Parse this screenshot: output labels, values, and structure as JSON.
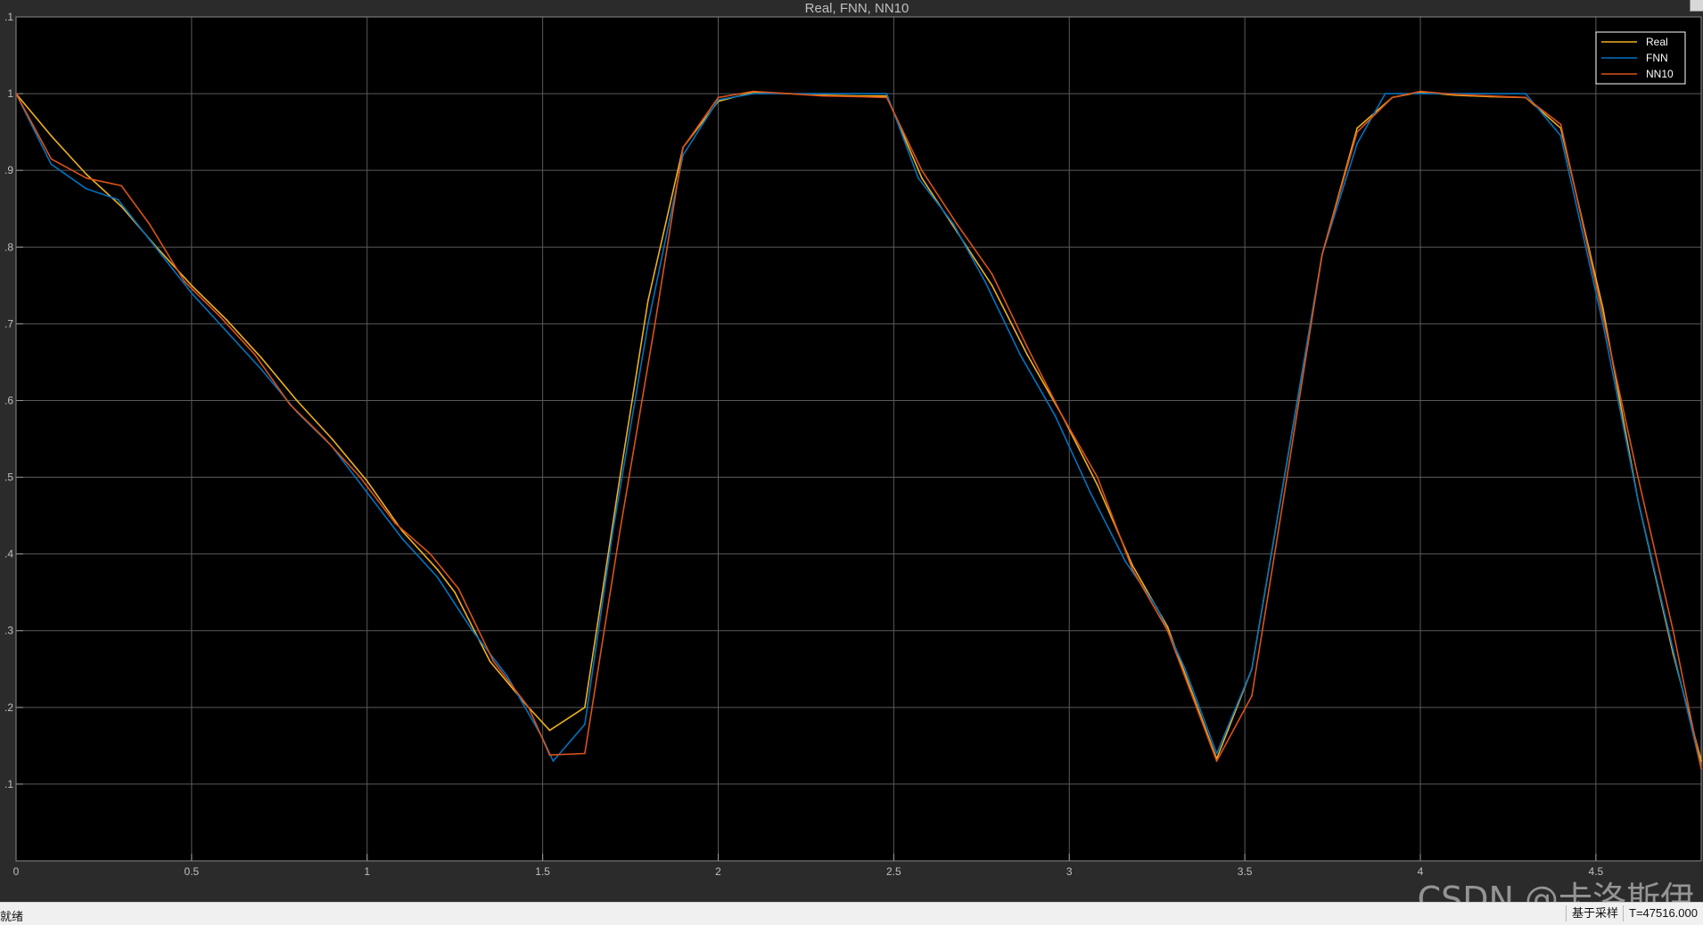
{
  "window": {
    "status_text": "就绪",
    "sampling_label": "基于采样",
    "time_readout": "T=47516.000",
    "watermark": "CSDN @卡洛斯伊"
  },
  "colors": {
    "background": "#000000",
    "frame": "#2b2b2b",
    "grid": "#5a5a5a",
    "axis_text": "#bfbfbf",
    "title_text": "#bfbfbf",
    "legend_border": "#ffffff"
  },
  "chart_data": {
    "type": "line",
    "title": "Real, FNN, NN10",
    "xlabel": "",
    "ylabel": "",
    "xlim": [
      0,
      4.8
    ],
    "ylim": [
      0,
      1.1
    ],
    "grid": true,
    "legend_position": "top-right",
    "x_ticks": [
      0,
      0.5,
      1,
      1.5,
      2,
      2.5,
      3,
      3.5,
      4,
      4.5
    ],
    "x_tick_labels": [
      "0",
      "0.5",
      "1",
      "1.5",
      "2",
      "2.5",
      "3",
      "3.5",
      "4",
      "4.5"
    ],
    "y_ticks": [
      0.1,
      0.2,
      0.3,
      0.4,
      0.5,
      0.6,
      0.7,
      0.8,
      0.9,
      1,
      1.1
    ],
    "y_tick_labels": [
      ".1",
      ".2",
      ".3",
      ".4",
      ".5",
      ".6",
      ".7",
      ".8",
      ".9",
      "1",
      ".1"
    ],
    "series": [
      {
        "name": "Real",
        "color": "#edb120",
        "points": [
          [
            0,
            1.0
          ],
          [
            0.1,
            0.945
          ],
          [
            0.2,
            0.895
          ],
          [
            0.3,
            0.853
          ],
          [
            0.4,
            0.8
          ],
          [
            0.5,
            0.75
          ],
          [
            0.6,
            0.705
          ],
          [
            0.7,
            0.655
          ],
          [
            0.8,
            0.6
          ],
          [
            0.9,
            0.55
          ],
          [
            1.0,
            0.495
          ],
          [
            1.1,
            0.43
          ],
          [
            1.2,
            0.38
          ],
          [
            1.25,
            0.35
          ],
          [
            1.35,
            0.26
          ],
          [
            1.45,
            0.205
          ],
          [
            1.52,
            0.17
          ],
          [
            1.62,
            0.2
          ],
          [
            1.72,
            0.5
          ],
          [
            1.8,
            0.73
          ],
          [
            1.9,
            0.93
          ],
          [
            2.0,
            0.99
          ],
          [
            2.1,
            1.002
          ],
          [
            2.2,
            1.0
          ],
          [
            2.3,
            0.998
          ],
          [
            2.4,
            0.997
          ],
          [
            2.48,
            0.997
          ],
          [
            2.58,
            0.89
          ],
          [
            2.68,
            0.82
          ],
          [
            2.78,
            0.75
          ],
          [
            2.88,
            0.66
          ],
          [
            2.98,
            0.58
          ],
          [
            3.08,
            0.49
          ],
          [
            3.18,
            0.385
          ],
          [
            3.28,
            0.305
          ],
          [
            3.42,
            0.133
          ],
          [
            3.52,
            0.25
          ],
          [
            3.62,
            0.52
          ],
          [
            3.72,
            0.79
          ],
          [
            3.82,
            0.955
          ],
          [
            3.92,
            0.995
          ],
          [
            4.0,
            1.002
          ],
          [
            4.1,
            0.998
          ],
          [
            4.2,
            0.996
          ],
          [
            4.3,
            0.995
          ],
          [
            4.4,
            0.955
          ],
          [
            4.52,
            0.72
          ],
          [
            4.62,
            0.47
          ],
          [
            4.72,
            0.27
          ],
          [
            4.8,
            0.13
          ]
        ]
      },
      {
        "name": "FNN",
        "color": "#0072bd",
        "points": [
          [
            0,
            1.0
          ],
          [
            0.1,
            0.908
          ],
          [
            0.2,
            0.876
          ],
          [
            0.29,
            0.862
          ],
          [
            0.38,
            0.81
          ],
          [
            0.5,
            0.74
          ],
          [
            0.6,
            0.69
          ],
          [
            0.7,
            0.64
          ],
          [
            0.8,
            0.585
          ],
          [
            0.9,
            0.54
          ],
          [
            1.0,
            0.48
          ],
          [
            1.1,
            0.42
          ],
          [
            1.2,
            0.37
          ],
          [
            1.3,
            0.3
          ],
          [
            1.4,
            0.24
          ],
          [
            1.5,
            0.16
          ],
          [
            1.53,
            0.13
          ],
          [
            1.62,
            0.178
          ],
          [
            1.7,
            0.43
          ],
          [
            1.8,
            0.7
          ],
          [
            1.9,
            0.92
          ],
          [
            2.0,
            0.992
          ],
          [
            2.1,
            1.0
          ],
          [
            2.2,
            1.0
          ],
          [
            2.3,
            1.0
          ],
          [
            2.4,
            1.0
          ],
          [
            2.48,
            1.0
          ],
          [
            2.57,
            0.89
          ],
          [
            2.67,
            0.83
          ],
          [
            2.76,
            0.755
          ],
          [
            2.86,
            0.66
          ],
          [
            2.96,
            0.58
          ],
          [
            3.06,
            0.48
          ],
          [
            3.16,
            0.39
          ],
          [
            3.25,
            0.33
          ],
          [
            3.33,
            0.25
          ],
          [
            3.42,
            0.14
          ],
          [
            3.52,
            0.25
          ],
          [
            3.62,
            0.52
          ],
          [
            3.72,
            0.79
          ],
          [
            3.82,
            0.935
          ],
          [
            3.9,
            1.0
          ],
          [
            4.0,
            1.0
          ],
          [
            4.1,
            1.0
          ],
          [
            4.2,
            1.0
          ],
          [
            4.3,
            1.0
          ],
          [
            4.4,
            0.945
          ],
          [
            4.52,
            0.7
          ],
          [
            4.62,
            0.47
          ],
          [
            4.72,
            0.275
          ],
          [
            4.8,
            0.12
          ]
        ]
      },
      {
        "name": "NN10",
        "color": "#d95319",
        "points": [
          [
            0,
            1.0
          ],
          [
            0.1,
            0.915
          ],
          [
            0.2,
            0.89
          ],
          [
            0.3,
            0.88
          ],
          [
            0.38,
            0.83
          ],
          [
            0.48,
            0.755
          ],
          [
            0.58,
            0.71
          ],
          [
            0.68,
            0.66
          ],
          [
            0.78,
            0.595
          ],
          [
            0.88,
            0.55
          ],
          [
            0.98,
            0.5
          ],
          [
            1.08,
            0.44
          ],
          [
            1.18,
            0.4
          ],
          [
            1.26,
            0.355
          ],
          [
            1.36,
            0.26
          ],
          [
            1.46,
            0.2
          ],
          [
            1.52,
            0.138
          ],
          [
            1.62,
            0.14
          ],
          [
            1.72,
            0.43
          ],
          [
            1.82,
            0.7
          ],
          [
            1.9,
            0.93
          ],
          [
            2.0,
            0.995
          ],
          [
            2.1,
            1.003
          ],
          [
            2.2,
            1.0
          ],
          [
            2.3,
            0.997
          ],
          [
            2.4,
            0.996
          ],
          [
            2.48,
            0.995
          ],
          [
            2.58,
            0.9
          ],
          [
            2.68,
            0.83
          ],
          [
            2.78,
            0.765
          ],
          [
            2.88,
            0.67
          ],
          [
            2.98,
            0.58
          ],
          [
            3.08,
            0.5
          ],
          [
            3.18,
            0.38
          ],
          [
            3.28,
            0.3
          ],
          [
            3.42,
            0.13
          ],
          [
            3.52,
            0.215
          ],
          [
            3.62,
            0.5
          ],
          [
            3.72,
            0.79
          ],
          [
            3.82,
            0.95
          ],
          [
            3.92,
            0.995
          ],
          [
            4.0,
            1.003
          ],
          [
            4.1,
            0.999
          ],
          [
            4.2,
            0.997
          ],
          [
            4.3,
            0.995
          ],
          [
            4.4,
            0.96
          ],
          [
            4.52,
            0.71
          ],
          [
            4.62,
            0.5
          ],
          [
            4.72,
            0.3
          ],
          [
            4.8,
            0.12
          ]
        ]
      }
    ]
  }
}
